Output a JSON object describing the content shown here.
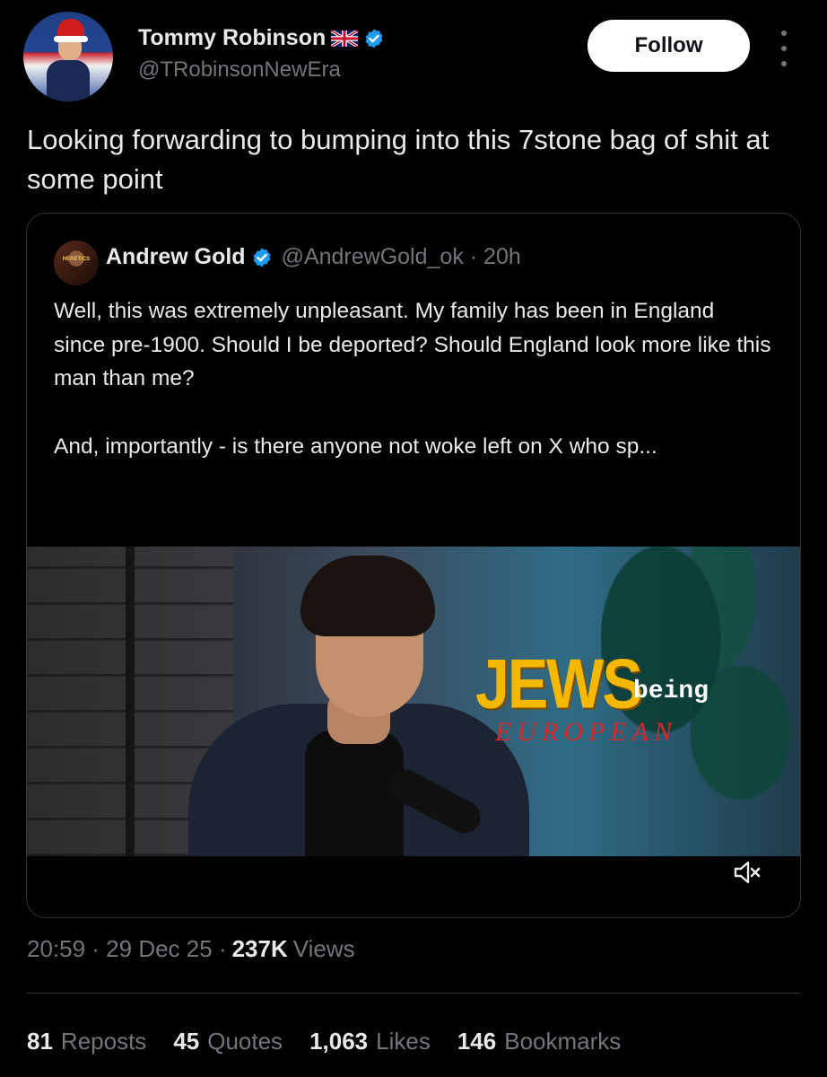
{
  "tweet": {
    "author": {
      "display_name": "Tommy Robinson",
      "handle": "@TRobinsonNewEra",
      "flag_icon": "uk-flag-icon",
      "verified_icon": "verified-badge-icon"
    },
    "follow_label": "Follow",
    "text": "Looking forwarding to bumping into this 7stone bag of shit at some point",
    "timestamp": "20:59 · 29 Dec 25 ·",
    "views_count": "237K",
    "views_label": "Views",
    "stats": {
      "reposts": {
        "count": "81",
        "label": "Reposts"
      },
      "quotes": {
        "count": "45",
        "label": "Quotes"
      },
      "likes": {
        "count": "1,063",
        "label": "Likes"
      },
      "bookmarks": {
        "count": "146",
        "label": "Bookmarks"
      }
    }
  },
  "quoted": {
    "avatar_text": "HERETICS",
    "display_name": "Andrew Gold",
    "handle_time": "@AndrewGold_ok · 20h",
    "text_para1": "Well, this was extremely unpleasant. My family has been in England since pre-1900. Should I be deported? Should England look more like this man than me?",
    "text_para2": "And, importantly - is there anyone not woke left on X who sp...",
    "video": {
      "title_main": "JEWS",
      "title_being": "being",
      "title_sub": "EUROPEAN",
      "mute_icon": "volume-muted-icon"
    }
  },
  "colors": {
    "background": "#000000",
    "text": "#e7e9ea",
    "muted": "#71767b",
    "verified": "#1d9bf0",
    "border": "#2f3336"
  }
}
